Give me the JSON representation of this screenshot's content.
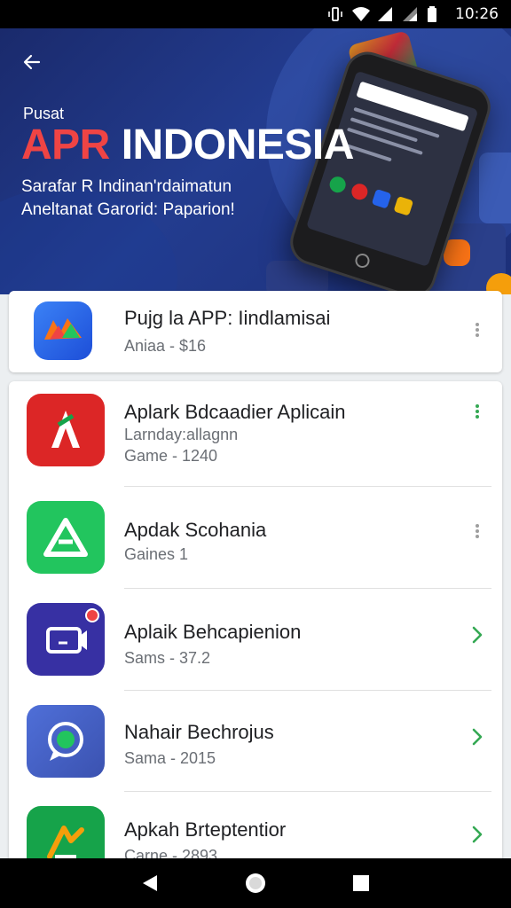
{
  "status_bar": {
    "time": "10:26"
  },
  "hero": {
    "small_label": "Pusat",
    "title_accent": "APR",
    "title_rest": "INDONESIA",
    "subtitle_line1": "Sarafar R Indinan'rdaimatun",
    "subtitle_line2": "Aneltanat Garorid: Paparion!"
  },
  "featured": {
    "name": "Pujg la APP: Iindlamisai",
    "meta": "Aniaa - $16"
  },
  "apps": [
    {
      "name": "Aplark Bdcaadier Aplicain",
      "meta_line1": "Larnday:allagnn",
      "meta": "Game - 1240",
      "action": "more",
      "icon": "red-a-icon"
    },
    {
      "name": "Apdak Scohania",
      "meta": "Gaines 1",
      "action": "more",
      "icon": "green-triangle-icon"
    },
    {
      "name": "Aplaik Behcapienion",
      "meta": "Sams - 37.2",
      "action": "chevron",
      "icon": "video-camera-icon"
    },
    {
      "name": "Nahair Bechrojus",
      "meta": "Sama - 2015",
      "action": "chevron",
      "icon": "chat-bubble-icon"
    },
    {
      "name": "Apkah Brteptentior",
      "meta": "Carne - 2893",
      "action": "chevron",
      "icon": "green-arrow-icon"
    }
  ],
  "colors": {
    "hero_bg": "#1c2f78",
    "accent_red": "#ef4444",
    "chevron_green": "#34a853"
  }
}
